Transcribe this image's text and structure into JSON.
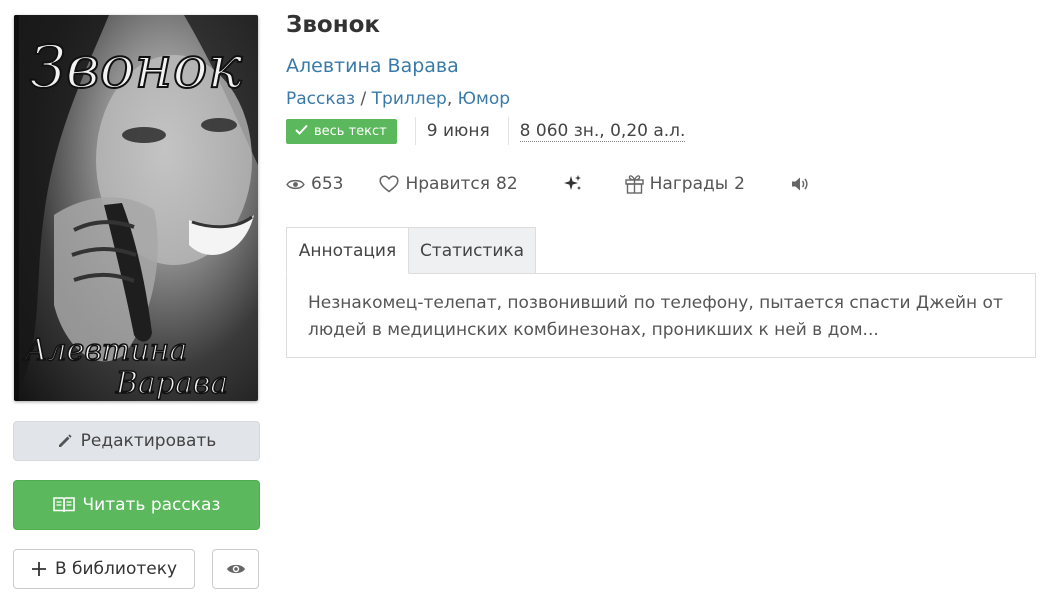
{
  "cover": {
    "title_text": "Звонок",
    "author_text_line1": "Алевтина",
    "author_text_line2": "Варава"
  },
  "book": {
    "title": "Звонок",
    "author": "Алевтина Варава",
    "genre_type": "Рассказ",
    "genre_sep": " / ",
    "genres": [
      "Триллер",
      "Юмор"
    ],
    "status_badge": "весь текст",
    "date": "9 июня",
    "volume": "8 060 зн., 0,20 а.л."
  },
  "stats": {
    "views": "653",
    "likes_label": "Нравится",
    "likes_count": "82",
    "awards_label": "Награды",
    "awards_count": "2"
  },
  "tabs": [
    {
      "label": "Аннотация",
      "active": true
    },
    {
      "label": "Статистика",
      "active": false
    }
  ],
  "annotation": "Незнакомец-телепат, позвонивший по телефону, пытается спасти Джейн от людей в медицинских комбинезонах, проникших к ней в дом...",
  "actions": {
    "edit_label": "Редактировать",
    "read_label": "Читать рассказ",
    "library_label": "В библиотеку"
  },
  "colors": {
    "link": "#3a7aa8",
    "success": "#5cb85c",
    "edit_bg": "#e1e4e8"
  },
  "icons": {
    "badge": "check-icon",
    "edit": "pencil-icon",
    "read": "open-book-icon",
    "library": "plus-icon",
    "watch": "eye-icon",
    "views": "eye-icon",
    "likes": "heart-icon",
    "sparkle": "sparkles-icon",
    "awards": "gift-icon",
    "audio": "speaker-icon"
  }
}
